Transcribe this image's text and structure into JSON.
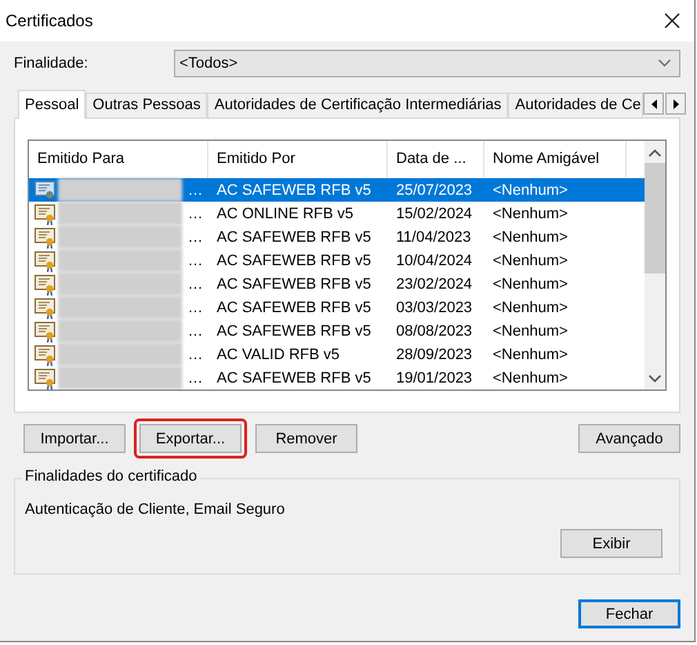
{
  "window": {
    "title": "Certificados"
  },
  "purpose": {
    "label": "Finalidade:",
    "value": "<Todos>"
  },
  "tabs": [
    {
      "label": "Pessoal",
      "selected": true
    },
    {
      "label": "Outras Pessoas",
      "selected": false
    },
    {
      "label": "Autoridades de Certificação Intermediárias",
      "selected": false
    },
    {
      "label": "Autoridades de Ce",
      "selected": false
    }
  ],
  "table": {
    "columns": [
      "Emitido Para",
      "Emitido Por",
      "Data de ...",
      "Nome Amigável"
    ],
    "rows": [
      {
        "issued_to": "…",
        "issued_by": "AC SAFEWEB RFB v5",
        "date": "25/07/2023",
        "friendly_name": "<Nenhum>",
        "selected": true
      },
      {
        "issued_to": "…",
        "issued_by": "AC ONLINE RFB v5",
        "date": "15/02/2024",
        "friendly_name": "<Nenhum>",
        "selected": false
      },
      {
        "issued_to": "…",
        "issued_by": "AC SAFEWEB RFB v5",
        "date": "11/04/2023",
        "friendly_name": "<Nenhum>",
        "selected": false
      },
      {
        "issued_to": "…",
        "issued_by": "AC SAFEWEB RFB v5",
        "date": "10/04/2024",
        "friendly_name": "<Nenhum>",
        "selected": false
      },
      {
        "issued_to": "…",
        "issued_by": "AC SAFEWEB RFB v5",
        "date": "23/02/2024",
        "friendly_name": "<Nenhum>",
        "selected": false
      },
      {
        "issued_to": "…",
        "issued_by": "AC SAFEWEB RFB v5",
        "date": "03/03/2023",
        "friendly_name": "<Nenhum>",
        "selected": false
      },
      {
        "issued_to": "…",
        "issued_by": "AC SAFEWEB RFB v5",
        "date": "08/08/2023",
        "friendly_name": "<Nenhum>",
        "selected": false
      },
      {
        "issued_to": "…",
        "issued_by": "AC VALID RFB v5",
        "date": "28/09/2023",
        "friendly_name": "<Nenhum>",
        "selected": false
      },
      {
        "issued_to": "…",
        "issued_by": "AC SAFEWEB RFB v5",
        "date": "19/01/2023",
        "friendly_name": "<Nenhum>",
        "selected": false
      }
    ]
  },
  "actions": [
    {
      "label": "Importar...",
      "highlighted": false
    },
    {
      "label": "Exportar...",
      "highlighted": true
    },
    {
      "label": "Remover",
      "highlighted": false
    }
  ],
  "advanced_button": "Avançado",
  "purposes_group": {
    "title": "Finalidades do certificado",
    "text": "Autenticação de Cliente, Email Seguro",
    "button": "Exibir"
  },
  "close_button": {
    "label": "Fechar",
    "default": true
  }
}
